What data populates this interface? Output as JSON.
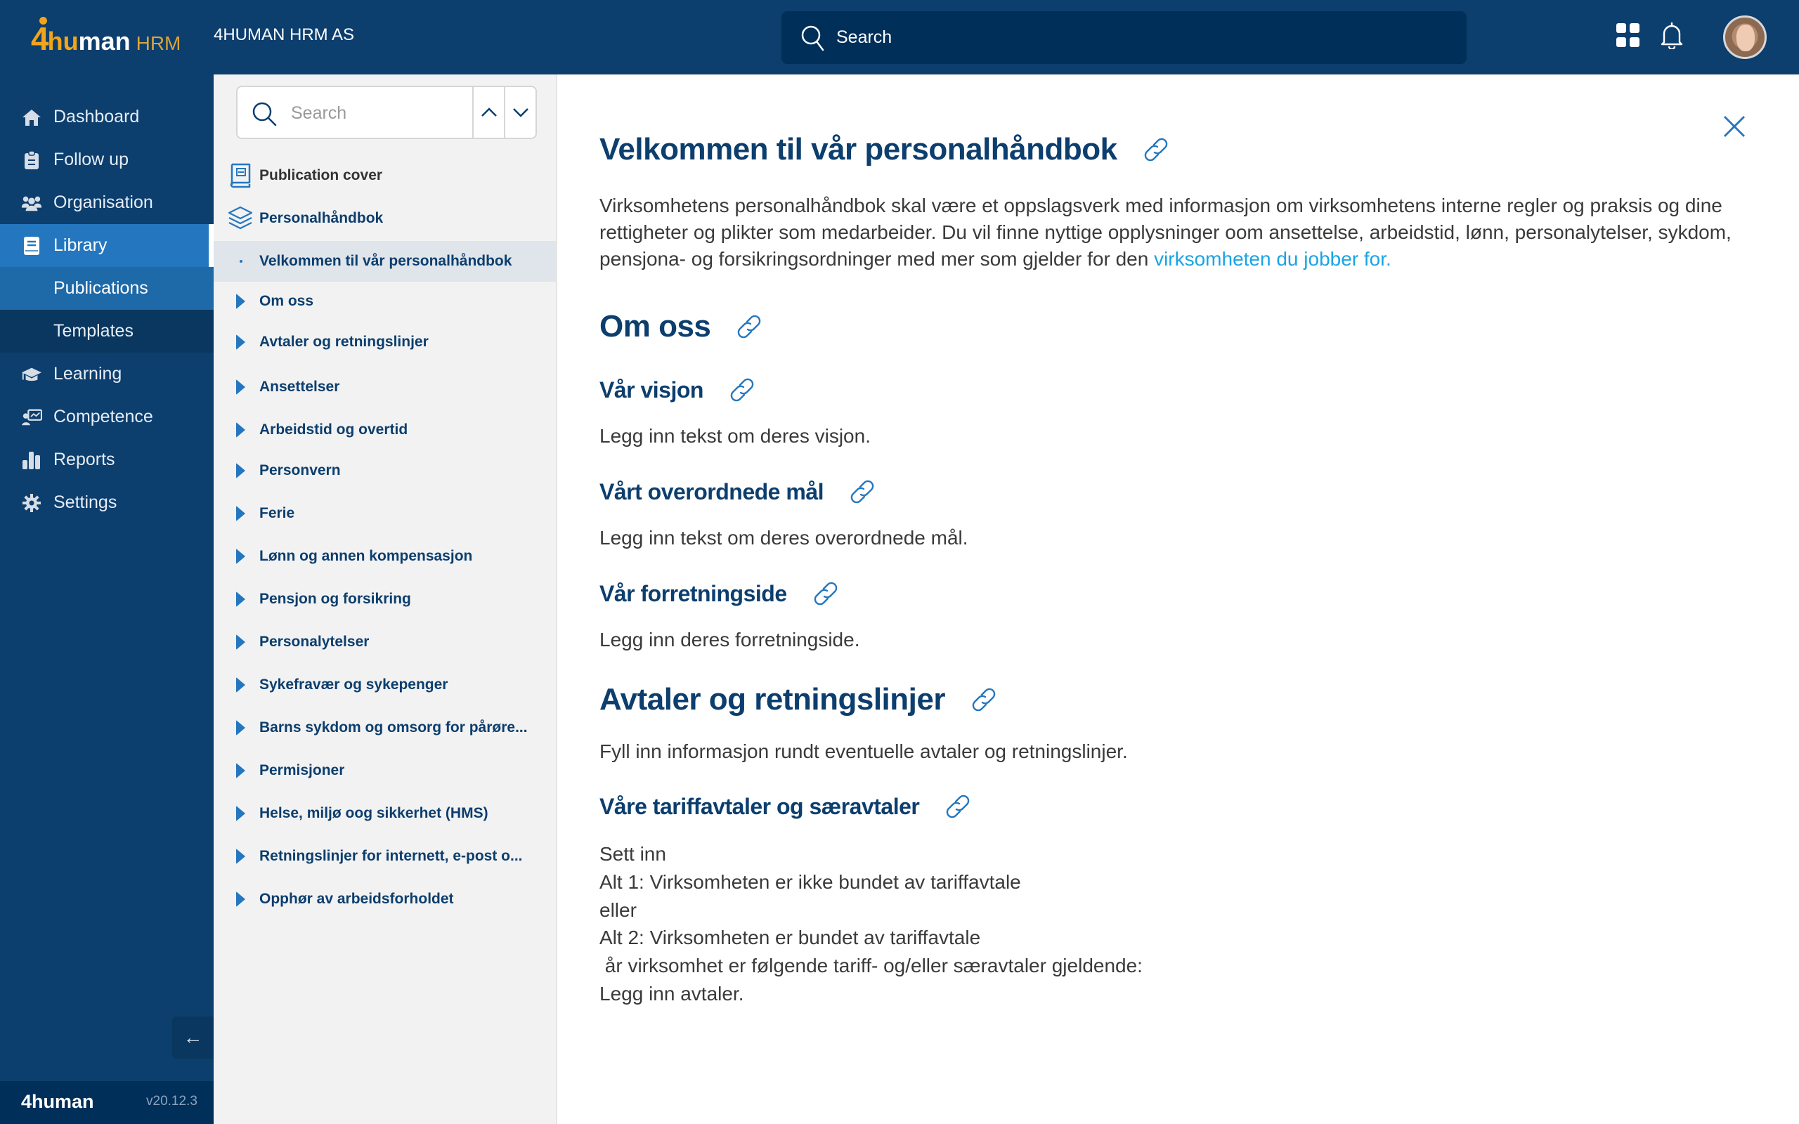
{
  "app": {
    "brand_four": "4",
    "brand_hu": "hu",
    "brand_man": "man",
    "brand_suffix": "HRM",
    "company": "4HUMAN HRM AS",
    "search_placeholder": "Search",
    "icons": {
      "apps": "grid-icon",
      "notifications": "bell-icon",
      "user": "avatar"
    }
  },
  "sidenav": {
    "items": [
      {
        "label": "Dashboard",
        "icon": "home-icon"
      },
      {
        "label": "Follow up",
        "icon": "clipboard-icon"
      },
      {
        "label": "Organisation",
        "icon": "users-icon"
      },
      {
        "label": "Library",
        "icon": "book-icon",
        "active": true
      },
      {
        "label": "Publications",
        "sub": true,
        "active": true
      },
      {
        "label": "Templates",
        "sub": true
      },
      {
        "label": "Learning",
        "icon": "graduation-cap-icon"
      },
      {
        "label": "Competence",
        "icon": "presentation-icon"
      },
      {
        "label": "Reports",
        "icon": "bar-chart-icon"
      },
      {
        "label": "Settings",
        "icon": "gear-icon"
      }
    ],
    "collapse_label": "←",
    "footer_logo": "4human",
    "version": "v20.12.3"
  },
  "toc": {
    "search_placeholder": "Search",
    "cover_label": "Publication cover",
    "book_label": "Personalhåndbok",
    "selected_label": "Velkommen til vår personalhåndbok",
    "chapters": [
      "Om oss",
      "Avtaler og retningslinjer",
      "Ansettelser",
      "Arbeidstid og overtid",
      "Personvern",
      "Ferie",
      "Lønn og annen kompensasjon",
      "Pensjon og forsikring",
      "Personalytelser",
      "Sykefravær og sykepenger",
      "Barns sykdom og  omsorg for pårøre...",
      "Permisjoner",
      "Helse, miljø oog sikkerhet (HMS)",
      "Retningslinjer for internett, e-post o...",
      "Opphør av arbeidsforholdet"
    ]
  },
  "content": {
    "title": "Velkommen til vår personalhåndbok",
    "intro": "Virksomhetens personalhåndbok skal være et oppslagsverk med informasjon om virksomhetens interne regler og praksis og dine rettigheter og plikter som medarbeider. Du vil finne nyttige opplysninger oom ansettelse, arbeidstid, lønn, personalytelser, sykdom, pensjona- og forsikringsordninger med mer som gjelder for den ",
    "intro_link": "virksomheten du jobber for.",
    "link_color": "#1aa3e6",
    "heading_color": "#0c3e6e",
    "sections": {
      "om_oss": "Om oss",
      "visjon_title": "Vår visjon",
      "visjon_text": "Legg inn tekst om deres visjon.",
      "maal_title": "Vårt overordnede mål",
      "maal_text": "Legg inn tekst om deres overordnede mål.",
      "forretning_title": "Vår forretningside",
      "forretning_text": "Legg inn deres forretningside.",
      "avtaler": "Avtaler og retningslinjer",
      "avtaler_text": "Fyll inn informasjon rundt eventuelle avtaler og retningslinjer.",
      "tariff_title": "Våre tariffavtaler og særavtaler",
      "tariff_lines": [
        "Sett inn",
        "Alt 1: Virksomheten er ikke bundet av tariffavtale",
        "eller",
        "Alt 2: Virksomheten er bundet av tariffavtale",
        " år virksomhet er følgende tariff- og/eller særavtaler gjeldende:",
        "Legg inn avtaler."
      ]
    }
  }
}
